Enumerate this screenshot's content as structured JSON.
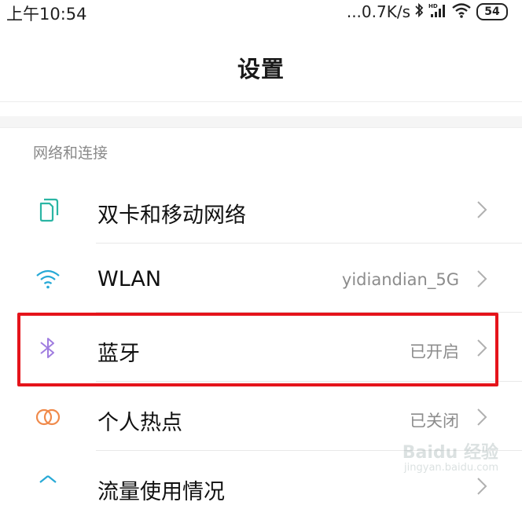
{
  "status_bar": {
    "time": "上午10:54",
    "net_speed": "...0.7K/s",
    "battery": "54",
    "icons": [
      "bluetooth-icon",
      "hd-signal-icon",
      "wifi-icon",
      "battery-icon"
    ]
  },
  "header": {
    "title": "设置"
  },
  "section": {
    "title": "网络和连接"
  },
  "rows": [
    {
      "icon": "dual-sim-icon",
      "label": "双卡和移动网络",
      "value": ""
    },
    {
      "icon": "wifi-icon",
      "label": "WLAN",
      "value": "yidiandian_5G"
    },
    {
      "icon": "bluetooth-icon",
      "label": "蓝牙",
      "value": "已开启"
    },
    {
      "icon": "hotspot-icon",
      "label": "个人热点",
      "value": "已关闭"
    },
    {
      "icon": "data-usage-icon",
      "label": "流量使用情况",
      "value": ""
    }
  ],
  "watermark": {
    "main": "Baidu 经验",
    "sub": "jingyan.baidu.com"
  },
  "colors": {
    "highlight": "#e5141b",
    "sim": "#2bb5a4",
    "wifi": "#27a9d6",
    "bluetooth": "#a07de0",
    "hotspot": "#f08a4b"
  }
}
